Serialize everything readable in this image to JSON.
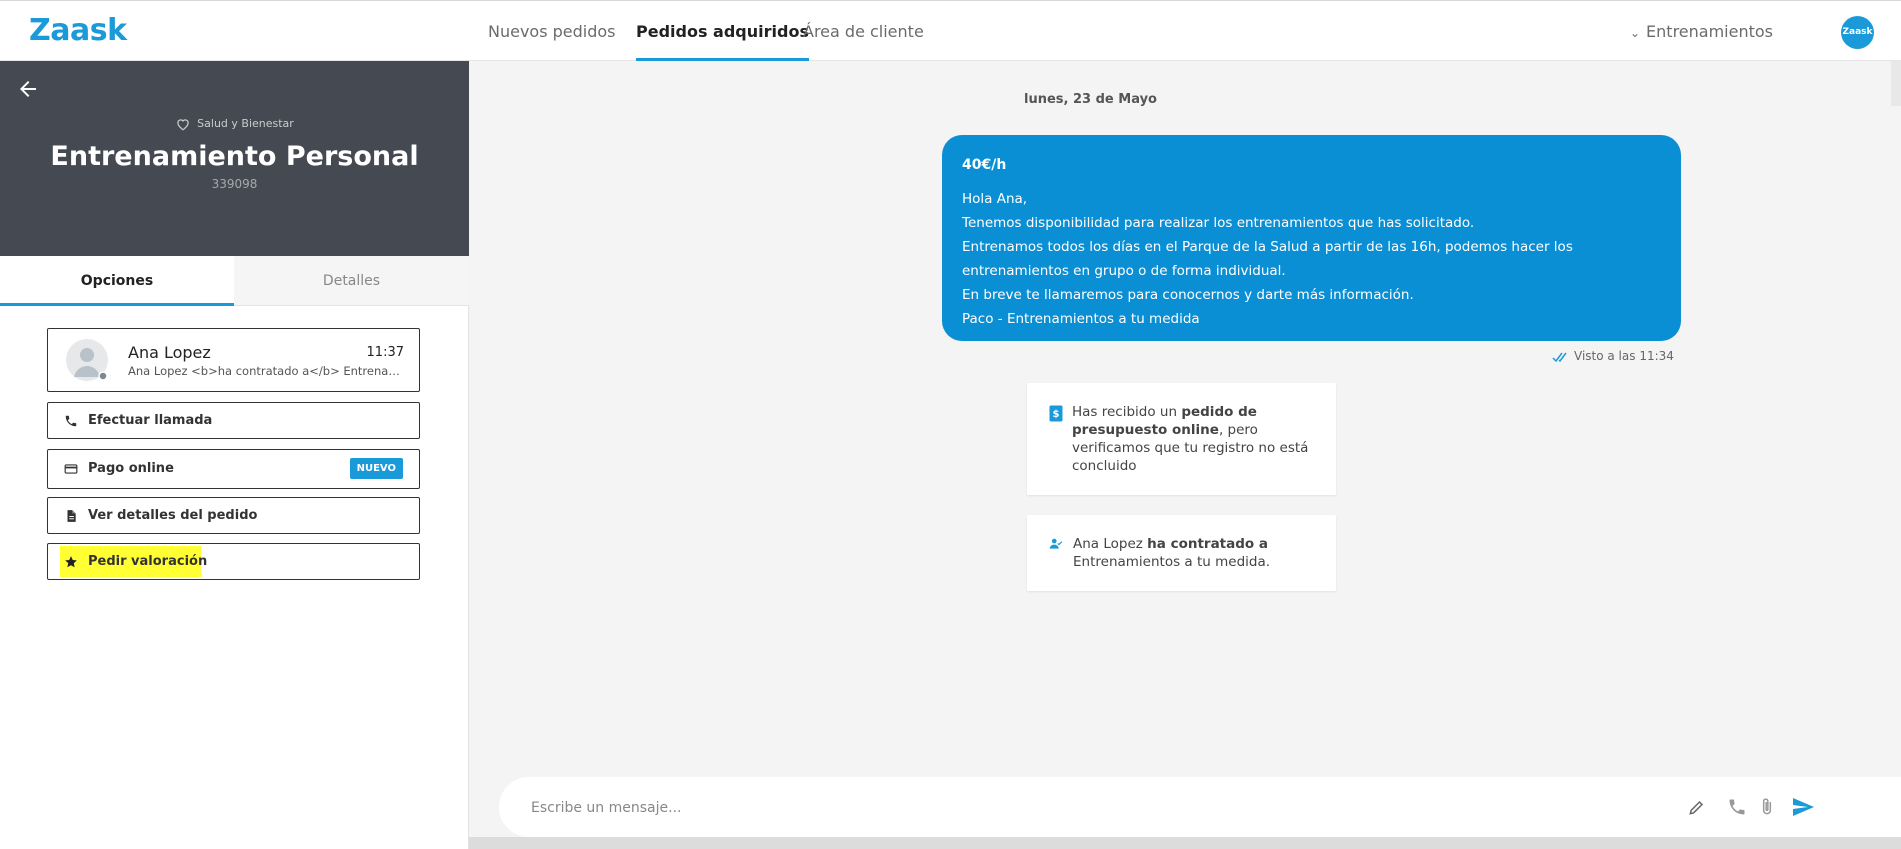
{
  "brand": {
    "name": "Zaask",
    "accent": "#1a9ad9"
  },
  "nav": {
    "tabs": [
      {
        "label": "Nuevos pedidos",
        "active": false
      },
      {
        "label": "Pedidos adquiridos",
        "active": true
      },
      {
        "label": "Área de cliente",
        "active": false
      }
    ],
    "account_label": "Entrenamientos",
    "avatar_text": "Zaask"
  },
  "sidebar": {
    "category": "Salud y Bienestar",
    "title": "Entrenamiento Personal",
    "order_id": "339098",
    "tabs": [
      {
        "label": "Opciones",
        "active": true
      },
      {
        "label": "Detalles",
        "active": false
      }
    ],
    "contact": {
      "name": "Ana Lopez",
      "time": "11:37",
      "preview": "Ana Lopez <b>ha contratado a</b> Entrenamientos a tu medida."
    },
    "options": [
      {
        "label": "Efectuar llamada",
        "icon": "phone-icon"
      },
      {
        "label": "Pago online",
        "icon": "card-icon",
        "badge": "NUEVO"
      },
      {
        "label": "Ver detalles del pedido",
        "icon": "document-icon"
      },
      {
        "label": "Pedir valoración",
        "icon": "star-icon",
        "highlighted": true
      }
    ]
  },
  "chat": {
    "date": "lunes, 23 de Mayo",
    "message": {
      "price": "40€/h",
      "lines": [
        "Hola Ana,",
        "Tenemos disponibilidad para realizar los entrenamientos que has solicitado.",
        "Entrenamos todos los días en el Parque de la Salud a partir de las 16h, podemos hacer los entrenamientos en grupo o de forma individual.",
        "En breve te llamaremos para conocernos y darte más información.",
        "Paco - Entrenamientos a tu medida"
      ],
      "seen": "Visto a las 11:34"
    },
    "notice1": {
      "pre": "Has recibido un ",
      "bold": "pedido de presupuesto online",
      "post": ", pero verificamos que tu registro no está concluido"
    },
    "notice2": {
      "pre": "Ana Lopez ",
      "bold": "ha contratado a",
      "post": " Entrenamientos a tu medida."
    },
    "composer_placeholder": "Escribe un mensaje..."
  }
}
